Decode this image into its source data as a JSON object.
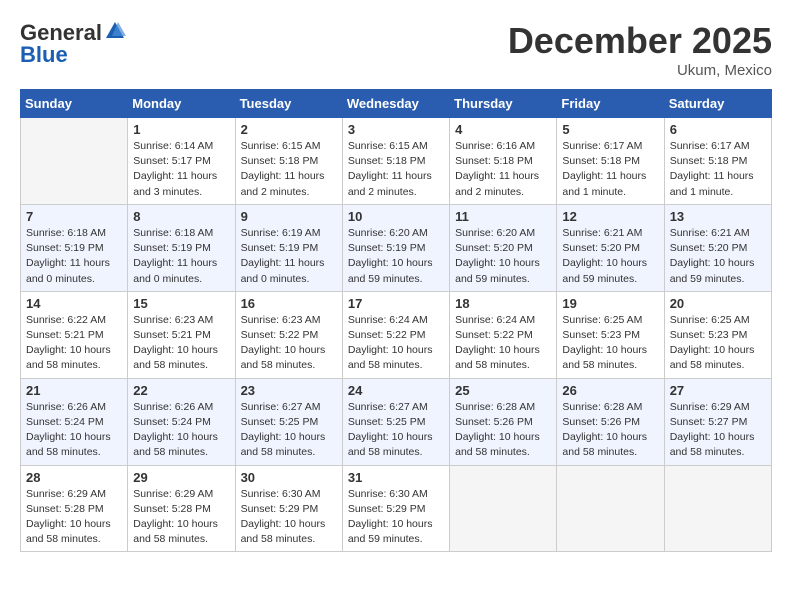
{
  "header": {
    "logo_general": "General",
    "logo_blue": "Blue",
    "month": "December 2025",
    "location": "Ukum, Mexico"
  },
  "days_of_week": [
    "Sunday",
    "Monday",
    "Tuesday",
    "Wednesday",
    "Thursday",
    "Friday",
    "Saturday"
  ],
  "weeks": [
    [
      {
        "day": "",
        "info": ""
      },
      {
        "day": "1",
        "info": "Sunrise: 6:14 AM\nSunset: 5:17 PM\nDaylight: 11 hours\nand 3 minutes."
      },
      {
        "day": "2",
        "info": "Sunrise: 6:15 AM\nSunset: 5:18 PM\nDaylight: 11 hours\nand 2 minutes."
      },
      {
        "day": "3",
        "info": "Sunrise: 6:15 AM\nSunset: 5:18 PM\nDaylight: 11 hours\nand 2 minutes."
      },
      {
        "day": "4",
        "info": "Sunrise: 6:16 AM\nSunset: 5:18 PM\nDaylight: 11 hours\nand 2 minutes."
      },
      {
        "day": "5",
        "info": "Sunrise: 6:17 AM\nSunset: 5:18 PM\nDaylight: 11 hours\nand 1 minute."
      },
      {
        "day": "6",
        "info": "Sunrise: 6:17 AM\nSunset: 5:18 PM\nDaylight: 11 hours\nand 1 minute."
      }
    ],
    [
      {
        "day": "7",
        "info": "Sunrise: 6:18 AM\nSunset: 5:19 PM\nDaylight: 11 hours\nand 0 minutes."
      },
      {
        "day": "8",
        "info": "Sunrise: 6:18 AM\nSunset: 5:19 PM\nDaylight: 11 hours\nand 0 minutes."
      },
      {
        "day": "9",
        "info": "Sunrise: 6:19 AM\nSunset: 5:19 PM\nDaylight: 11 hours\nand 0 minutes."
      },
      {
        "day": "10",
        "info": "Sunrise: 6:20 AM\nSunset: 5:19 PM\nDaylight: 10 hours\nand 59 minutes."
      },
      {
        "day": "11",
        "info": "Sunrise: 6:20 AM\nSunset: 5:20 PM\nDaylight: 10 hours\nand 59 minutes."
      },
      {
        "day": "12",
        "info": "Sunrise: 6:21 AM\nSunset: 5:20 PM\nDaylight: 10 hours\nand 59 minutes."
      },
      {
        "day": "13",
        "info": "Sunrise: 6:21 AM\nSunset: 5:20 PM\nDaylight: 10 hours\nand 59 minutes."
      }
    ],
    [
      {
        "day": "14",
        "info": "Sunrise: 6:22 AM\nSunset: 5:21 PM\nDaylight: 10 hours\nand 58 minutes."
      },
      {
        "day": "15",
        "info": "Sunrise: 6:23 AM\nSunset: 5:21 PM\nDaylight: 10 hours\nand 58 minutes."
      },
      {
        "day": "16",
        "info": "Sunrise: 6:23 AM\nSunset: 5:22 PM\nDaylight: 10 hours\nand 58 minutes."
      },
      {
        "day": "17",
        "info": "Sunrise: 6:24 AM\nSunset: 5:22 PM\nDaylight: 10 hours\nand 58 minutes."
      },
      {
        "day": "18",
        "info": "Sunrise: 6:24 AM\nSunset: 5:22 PM\nDaylight: 10 hours\nand 58 minutes."
      },
      {
        "day": "19",
        "info": "Sunrise: 6:25 AM\nSunset: 5:23 PM\nDaylight: 10 hours\nand 58 minutes."
      },
      {
        "day": "20",
        "info": "Sunrise: 6:25 AM\nSunset: 5:23 PM\nDaylight: 10 hours\nand 58 minutes."
      }
    ],
    [
      {
        "day": "21",
        "info": "Sunrise: 6:26 AM\nSunset: 5:24 PM\nDaylight: 10 hours\nand 58 minutes."
      },
      {
        "day": "22",
        "info": "Sunrise: 6:26 AM\nSunset: 5:24 PM\nDaylight: 10 hours\nand 58 minutes."
      },
      {
        "day": "23",
        "info": "Sunrise: 6:27 AM\nSunset: 5:25 PM\nDaylight: 10 hours\nand 58 minutes."
      },
      {
        "day": "24",
        "info": "Sunrise: 6:27 AM\nSunset: 5:25 PM\nDaylight: 10 hours\nand 58 minutes."
      },
      {
        "day": "25",
        "info": "Sunrise: 6:28 AM\nSunset: 5:26 PM\nDaylight: 10 hours\nand 58 minutes."
      },
      {
        "day": "26",
        "info": "Sunrise: 6:28 AM\nSunset: 5:26 PM\nDaylight: 10 hours\nand 58 minutes."
      },
      {
        "day": "27",
        "info": "Sunrise: 6:29 AM\nSunset: 5:27 PM\nDaylight: 10 hours\nand 58 minutes."
      }
    ],
    [
      {
        "day": "28",
        "info": "Sunrise: 6:29 AM\nSunset: 5:28 PM\nDaylight: 10 hours\nand 58 minutes."
      },
      {
        "day": "29",
        "info": "Sunrise: 6:29 AM\nSunset: 5:28 PM\nDaylight: 10 hours\nand 58 minutes."
      },
      {
        "day": "30",
        "info": "Sunrise: 6:30 AM\nSunset: 5:29 PM\nDaylight: 10 hours\nand 58 minutes."
      },
      {
        "day": "31",
        "info": "Sunrise: 6:30 AM\nSunset: 5:29 PM\nDaylight: 10 hours\nand 59 minutes."
      },
      {
        "day": "",
        "info": ""
      },
      {
        "day": "",
        "info": ""
      },
      {
        "day": "",
        "info": ""
      }
    ]
  ]
}
